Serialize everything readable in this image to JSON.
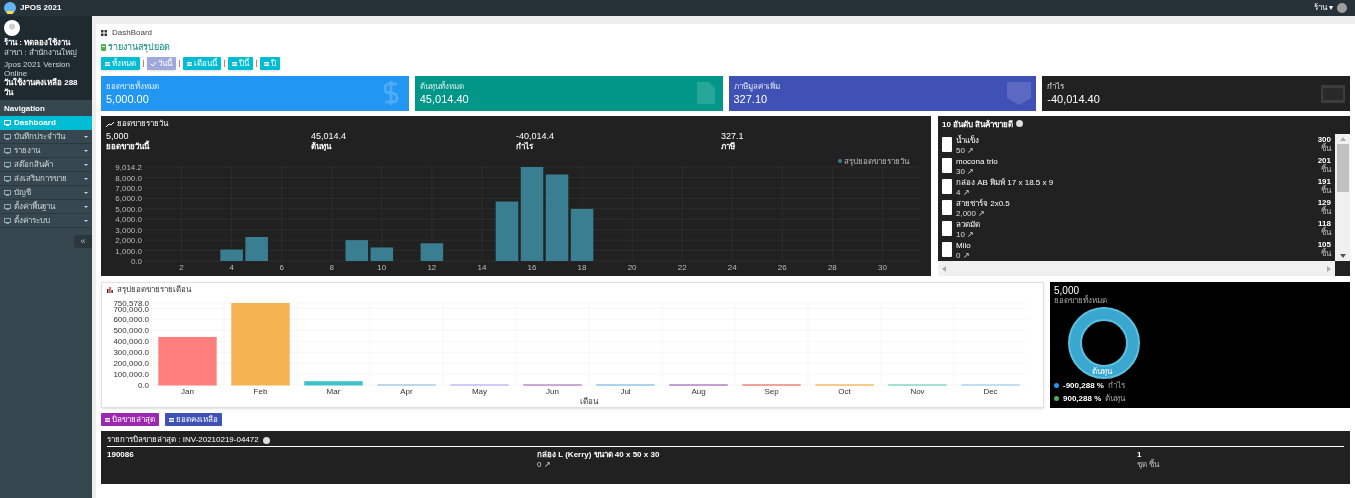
{
  "topbar": {
    "app_title": "JPOS 2021",
    "user_menu": "ร้าน ▾"
  },
  "sidebar": {
    "shop": "ร้าน : ทดลองใช้งาน",
    "branch": "สาขา : สำนักงานใหญ่",
    "version": "Jpos 2021 Version Online",
    "days_left": "วันใช้งานคงเหลือ 288 วัน",
    "section": "Navigation",
    "collapse": "«",
    "items": [
      {
        "label": "Dashboard",
        "selected": true,
        "has_submenu": false
      },
      {
        "label": "บันทึกประจำวัน",
        "selected": false,
        "has_submenu": true
      },
      {
        "label": "รายงาน",
        "selected": false,
        "has_submenu": true
      },
      {
        "label": "สต๊อกสินค้า",
        "selected": false,
        "has_submenu": true
      },
      {
        "label": "ส่งเสริมการขาย",
        "selected": false,
        "has_submenu": true
      },
      {
        "label": "บัญชี",
        "selected": false,
        "has_submenu": true
      },
      {
        "label": "ตั้งค่าพื้นฐาน",
        "selected": false,
        "has_submenu": true
      },
      {
        "label": "ตั้งค่าระบบ",
        "selected": false,
        "has_submenu": true
      }
    ]
  },
  "breadcrumb": "DashBoard",
  "page_title": "รายงานสรุปยอด",
  "period_buttons": [
    {
      "label": "ทั้งหมด",
      "selected": false
    },
    {
      "label": "วันนี้",
      "selected": true
    },
    {
      "label": "เดือนนี้",
      "selected": false
    },
    {
      "label": "ปีนี้",
      "selected": false
    },
    {
      "label": "ปี",
      "selected": false
    }
  ],
  "stat_cards": [
    {
      "label": "ยอดขายทั้งหมด",
      "value": "5,000.00",
      "color": "#2196f3"
    },
    {
      "label": "ต้นทุนทั้งหมด",
      "value": "45,014.40",
      "color": "#009688"
    },
    {
      "label": "ภาษีมูลค่าเพิ่ม",
      "value": "327.10",
      "color": "#3f51b5"
    },
    {
      "label": "กำไร",
      "value": "-40,014.40",
      "color": "#212121"
    }
  ],
  "daily_panel": {
    "title": "ยอดขายรายวัน",
    "stats": [
      {
        "value": "5,000",
        "label": "ยอดขายวันนี้"
      },
      {
        "value": "45,014.4",
        "label": "ต้นทุน"
      },
      {
        "value": "-40,014.4",
        "label": "กำไร"
      },
      {
        "value": "327.1",
        "label": "ภาษี"
      }
    ],
    "chart_data": {
      "type": "bar",
      "grid": true,
      "legend": true,
      "x": [
        1,
        2,
        3,
        4,
        5,
        6,
        7,
        8,
        9,
        10,
        11,
        12,
        13,
        14,
        15,
        16,
        17,
        18,
        19,
        20,
        21,
        22,
        23,
        24,
        25,
        26,
        27,
        28,
        29,
        30,
        31
      ],
      "series": [
        {
          "name": "สรุปยอดขายรายวัน",
          "color": "#3a7f91",
          "values": [
            0,
            0,
            0,
            1100,
            2300,
            0,
            0,
            0,
            2000,
            1300,
            0,
            1700,
            0,
            0,
            5700,
            9014.2,
            8300,
            5000,
            0,
            0,
            0,
            0,
            0,
            0,
            0,
            0,
            0,
            0,
            0,
            0,
            0
          ]
        }
      ],
      "xlim": [
        0.5,
        31.5
      ],
      "xticks": [
        2,
        4,
        6,
        8,
        10,
        12,
        14,
        16,
        18,
        20,
        22,
        24,
        26,
        28,
        30
      ],
      "ylim": [
        0,
        9014.2
      ],
      "yticks": [
        {
          "value": 0,
          "label": "0.0"
        },
        {
          "value": 1000,
          "label": "1,000.0"
        },
        {
          "value": 2000,
          "label": "2,000.0"
        },
        {
          "value": 3000,
          "label": "3,000.0"
        },
        {
          "value": 4000,
          "label": "4,000.0"
        },
        {
          "value": 5000,
          "label": "5,000.0"
        },
        {
          "value": 6000,
          "label": "6,000.0"
        },
        {
          "value": 7000,
          "label": "7,000.0"
        },
        {
          "value": 8000,
          "label": "8,000.0"
        },
        {
          "value": 9014.2,
          "label": "9,014.2"
        }
      ]
    }
  },
  "top_products": {
    "title": "10 อันดับ สินค้าขายดี",
    "items": [
      {
        "name": "น้ำแข็ง",
        "qty": "50 ↗",
        "count": "300",
        "unit": "ชิ้น"
      },
      {
        "name": "mocona trio",
        "qty": "30 ↗",
        "count": "201",
        "unit": "ชิ้น"
      },
      {
        "name": "กล่อง AB พิมพ์ 17 x 18.5 x 9",
        "qty": "4 ↗",
        "count": "191",
        "unit": "ชิ้น"
      },
      {
        "name": "สายชาร์จ 2x0.5",
        "qty": "2,000 ↗",
        "count": "129",
        "unit": "ชิ้น"
      },
      {
        "name": "ลวดมัด",
        "qty": "10 ↗",
        "count": "118",
        "unit": "ชิ้น"
      },
      {
        "name": "Milo",
        "qty": "0 ↗",
        "count": "105",
        "unit": "ชิ้น"
      }
    ]
  },
  "monthly_panel": {
    "title": "สรุปยอดขายรายเดือน",
    "chart_data": {
      "type": "bar",
      "grid": true,
      "xlabel": "เดือน",
      "categories": [
        "Jan",
        "Feb",
        "Mar",
        "Apr",
        "May",
        "Jun",
        "Jul",
        "Aug",
        "Sep",
        "Oct",
        "Nov",
        "Dec"
      ],
      "values": [
        440000,
        750578,
        35000,
        0,
        0,
        0,
        0,
        0,
        0,
        0,
        0,
        0
      ],
      "ylim": [
        0,
        750578
      ],
      "yticks": [
        {
          "value": 0,
          "label": "0.0"
        },
        {
          "value": 100000,
          "label": "100,000.0"
        },
        {
          "value": 200000,
          "label": "200,000.0"
        },
        {
          "value": 300000,
          "label": "300,000.0"
        },
        {
          "value": 400000,
          "label": "400,000.0"
        },
        {
          "value": 500000,
          "label": "500,000.0"
        },
        {
          "value": 600000,
          "label": "600,000.0"
        },
        {
          "value": 700000,
          "label": "700,000.0"
        },
        {
          "value": 750578,
          "label": "750,578.0"
        }
      ]
    }
  },
  "summary_card": {
    "value": "5,000",
    "label": "ยอดขายทั้งหมด",
    "ring_label": "ต้นทุน",
    "legend": [
      {
        "value": "-900,288 %",
        "label": "กำไร",
        "color": "#2196f3"
      },
      {
        "value": "900,288 %",
        "label": "ต้นทุน",
        "color": "#4caf50"
      }
    ]
  },
  "bottom_buttons": [
    {
      "label": "บิลขายล่าสุด",
      "color": "#9c27b0"
    },
    {
      "label": "ยอดคงเหลือ",
      "color": "#3f51b5"
    }
  ],
  "last_bill": {
    "title": "รายการบิลขายล่าสุด : INV-20210219-04472",
    "rows": [
      {
        "code": "190086",
        "name": "กล่อง L (Kerry) ขนาด 40 x 50 x 30",
        "qty": "0 ↗",
        "count": "1",
        "unit": "ชุด ชิ้น"
      }
    ]
  }
}
